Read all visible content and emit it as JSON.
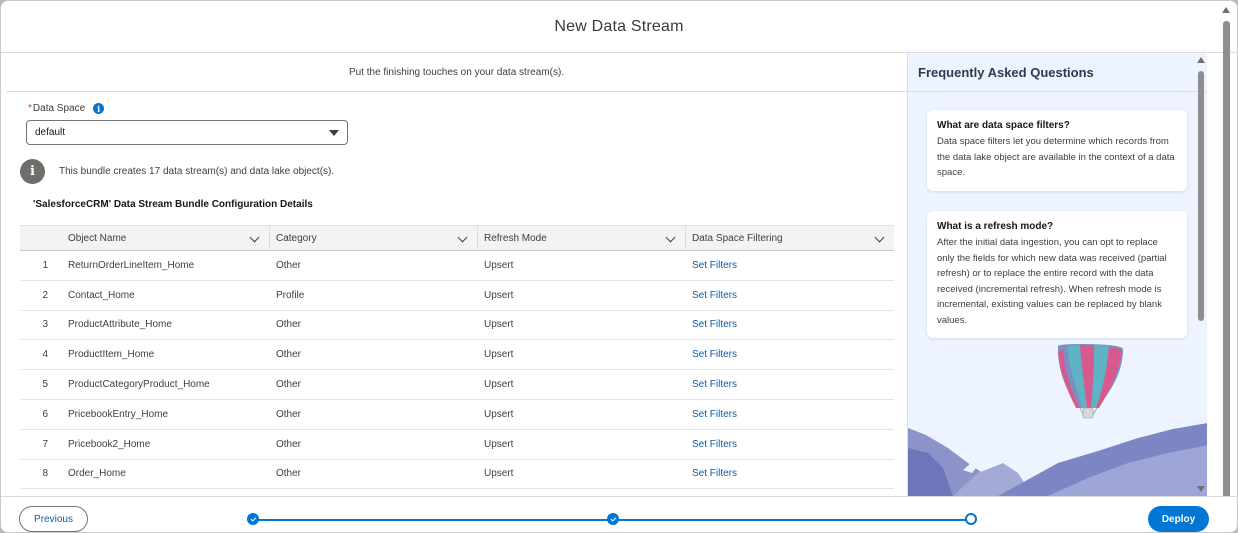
{
  "modal": {
    "title": "New Data Stream"
  },
  "main": {
    "subtitle": "Put the finishing touches on your data stream(s).",
    "data_space": {
      "required_mark": "*",
      "label": "Data Space",
      "value": "default"
    },
    "notice": "This bundle creates 17 data stream(s) and data lake object(s).",
    "bundle_title": "'SalesforceCRM' Data Stream Bundle Configuration Details",
    "table": {
      "columns": [
        "Object Name",
        "Category",
        "Refresh Mode",
        "Data Space Filtering"
      ],
      "rows": [
        {
          "num": "1",
          "name": "ReturnOrderLineItem_Home",
          "category": "Other",
          "mode": "Upsert",
          "filter": "Set Filters"
        },
        {
          "num": "2",
          "name": "Contact_Home",
          "category": "Profile",
          "mode": "Upsert",
          "filter": "Set Filters"
        },
        {
          "num": "3",
          "name": "ProductAttribute_Home",
          "category": "Other",
          "mode": "Upsert",
          "filter": "Set Filters"
        },
        {
          "num": "4",
          "name": "ProductItem_Home",
          "category": "Other",
          "mode": "Upsert",
          "filter": "Set Filters"
        },
        {
          "num": "5",
          "name": "ProductCategoryProduct_Home",
          "category": "Other",
          "mode": "Upsert",
          "filter": "Set Filters"
        },
        {
          "num": "6",
          "name": "PricebookEntry_Home",
          "category": "Other",
          "mode": "Upsert",
          "filter": "Set Filters"
        },
        {
          "num": "7",
          "name": "Pricebook2_Home",
          "category": "Other",
          "mode": "Upsert",
          "filter": "Set Filters"
        },
        {
          "num": "8",
          "name": "Order_Home",
          "category": "Other",
          "mode": "Upsert",
          "filter": "Set Filters"
        }
      ]
    }
  },
  "faq": {
    "title": "Frequently Asked Questions",
    "items": [
      {
        "q": "What are data space filters?",
        "a": "Data space filters let you determine which records from the data lake object are available in the context of a data space."
      },
      {
        "q": "What is a refresh mode?",
        "a": "After the initial data ingestion, you can opt to replace only the fields for which new data was received (partial refresh) or to replace the entire record with the data received (incremental refresh). When refresh mode is incremental, existing values can be replaced by blank values."
      }
    ]
  },
  "footer": {
    "previous": "Previous",
    "deploy": "Deploy"
  },
  "colors": {
    "brand": "#0176d3",
    "link": "#0b5cab",
    "faq_bg": "#eef4ff"
  }
}
